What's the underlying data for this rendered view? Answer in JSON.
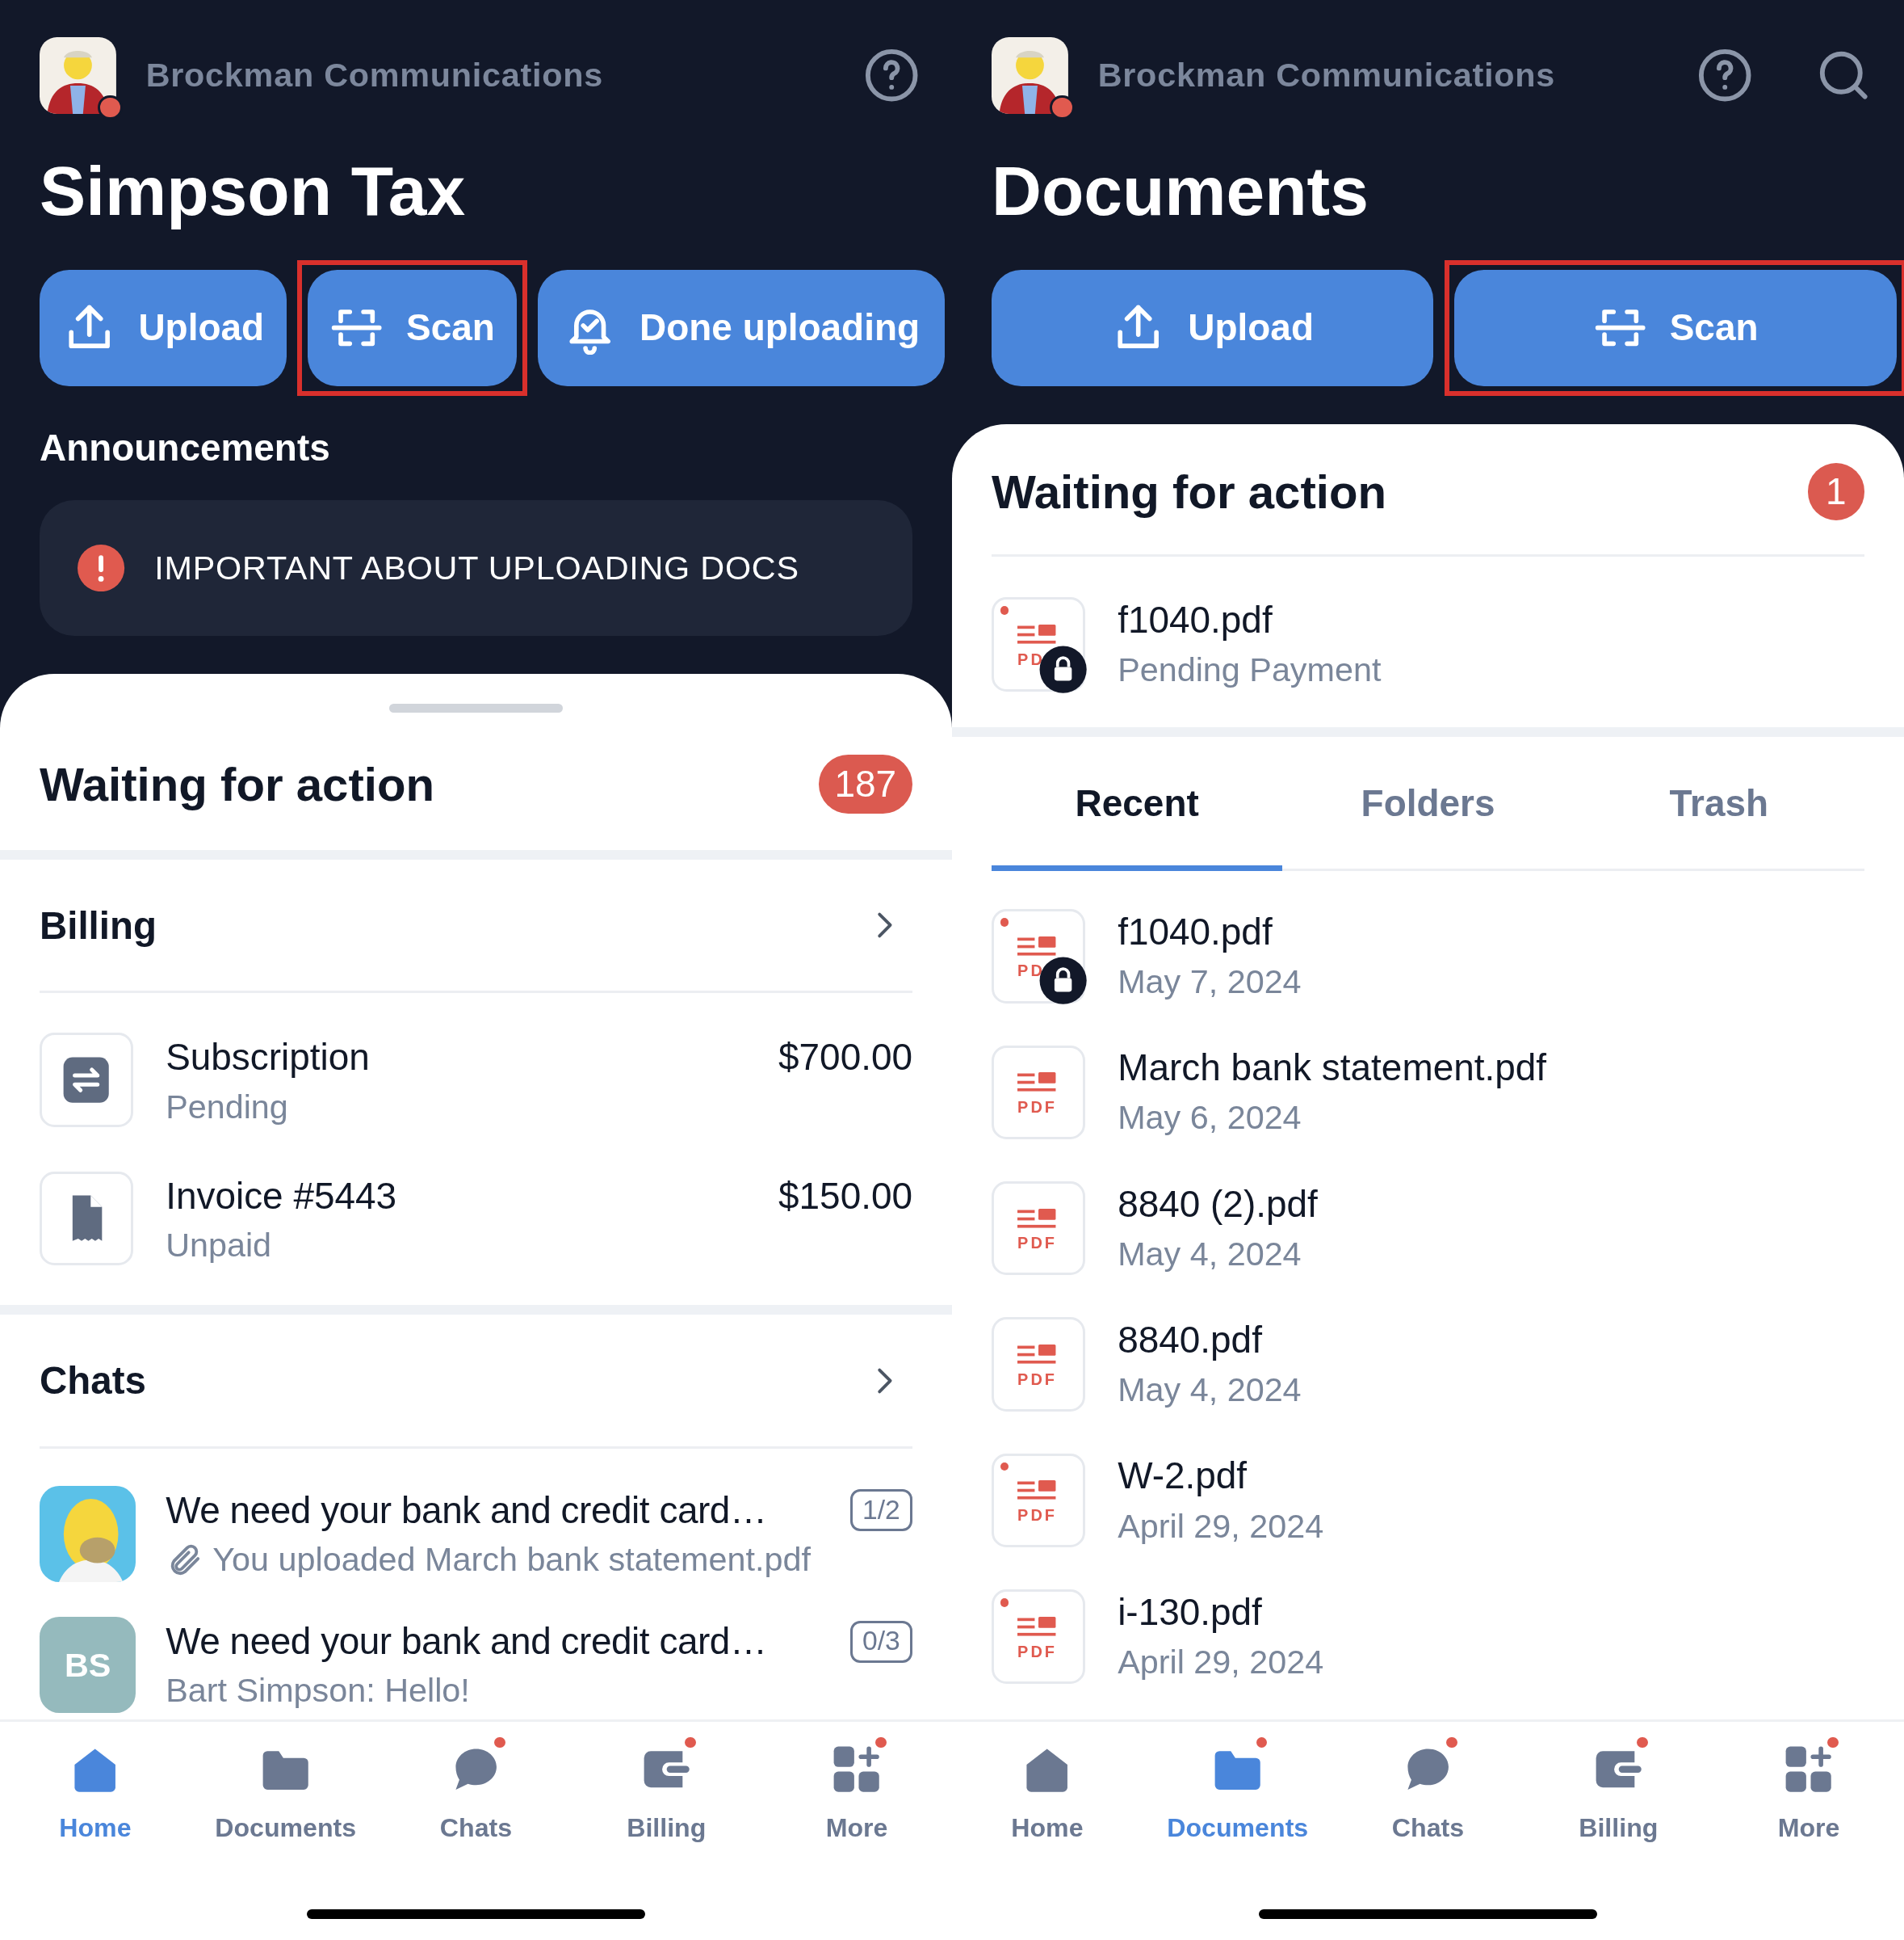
{
  "screens": [
    {
      "kind": "home",
      "header": {
        "avatar_alert": true,
        "company": "Brockman Communications",
        "icons": [
          {
            "kind": "help"
          }
        ]
      },
      "title": "Simpson Tax",
      "buttons": [
        {
          "kind": "upload",
          "label": "Upload",
          "highlighted": false
        },
        {
          "kind": "scan",
          "label": "Scan",
          "highlighted": true
        },
        {
          "kind": "bell",
          "label": "Done uploading",
          "highlighted": false
        }
      ],
      "announcements": {
        "title": "Announcements",
        "items": [
          "IMPORTANT ABOUT UPLOADING DOCS"
        ]
      },
      "waiting": {
        "title": "Waiting for action",
        "count": "187"
      },
      "billing": {
        "title": "Billing",
        "items": [
          {
            "kind": "repeat",
            "title": "Subscription",
            "status": "Pending",
            "amount": "$700.00"
          },
          {
            "kind": "receipt",
            "title": "Invoice #5443",
            "status": "Unpaid",
            "amount": "$150.00"
          }
        ]
      },
      "chats": {
        "title": "Chats",
        "items": [
          {
            "title": "We need your bank and credit card…",
            "progress": "1/2",
            "preview": "You uploaded March bank statement.pdf",
            "attachment": true
          },
          {
            "avatar": {
              "kind": "initials",
              "initials": "BS"
            },
            "title": "We need your bank and credit card…",
            "progress": "0/3",
            "preview": "Bart Simpson: Hello!",
            "attachment": false
          }
        ]
      },
      "tabbar": [
        {
          "kind": "home",
          "label": "Home",
          "selected": true,
          "dot": false
        },
        {
          "kind": "folder",
          "label": "Documents",
          "selected": false,
          "dot": false
        },
        {
          "kind": "chat",
          "label": "Chats",
          "selected": false,
          "dot": true
        },
        {
          "kind": "wallet",
          "label": "Billing",
          "selected": false,
          "dot": true
        },
        {
          "kind": "more",
          "label": "More",
          "selected": false,
          "dot": true
        }
      ]
    },
    {
      "kind": "documents",
      "header": {
        "avatar_alert": true,
        "company": "Brockman Communications",
        "icons": [
          {
            "kind": "help"
          },
          {
            "kind": "search"
          }
        ]
      },
      "title": "Documents",
      "buttons": [
        {
          "kind": "upload",
          "label": "Upload",
          "highlighted": false
        },
        {
          "kind": "scan",
          "label": "Scan",
          "highlighted": true
        }
      ],
      "waiting": {
        "title": "Waiting for action",
        "count": "1",
        "files": [
          {
            "name": "f1040.pdf",
            "subtitle": "Pending Payment",
            "icon_label": "PD",
            "locked": true,
            "unread": true
          }
        ]
      },
      "tabs": [
        {
          "label": "Recent",
          "selected": true
        },
        {
          "label": "Folders",
          "selected": false
        },
        {
          "label": "Trash",
          "selected": false
        }
      ],
      "files": [
        {
          "name": "f1040.pdf",
          "subtitle": "May 7, 2024",
          "icon_label": "PD",
          "locked": true,
          "unread": true
        },
        {
          "name": "March bank statement.pdf",
          "subtitle": "May 6, 2024",
          "icon_label": "PDF",
          "locked": false,
          "unread": false
        },
        {
          "name": "8840 (2).pdf",
          "subtitle": "May 4, 2024",
          "icon_label": "PDF",
          "locked": false,
          "unread": false
        },
        {
          "name": "8840.pdf",
          "subtitle": "May 4, 2024",
          "icon_label": "PDF",
          "locked": false,
          "unread": false
        },
        {
          "name": "W-2.pdf",
          "subtitle": "April 29, 2024",
          "icon_label": "PDF",
          "locked": false,
          "unread": true
        },
        {
          "name": "i-130.pdf",
          "subtitle": "April 29, 2024",
          "icon_label": "PDF",
          "locked": false,
          "unread": true
        }
      ],
      "tabbar": [
        {
          "kind": "home",
          "label": "Home",
          "selected": false,
          "dot": false
        },
        {
          "kind": "folder",
          "label": "Documents",
          "selected": true,
          "dot": true
        },
        {
          "kind": "chat",
          "label": "Chats",
          "selected": false,
          "dot": true
        },
        {
          "kind": "wallet",
          "label": "Billing",
          "selected": false,
          "dot": true
        },
        {
          "kind": "more",
          "label": "More",
          "selected": false,
          "dot": true
        }
      ]
    }
  ]
}
